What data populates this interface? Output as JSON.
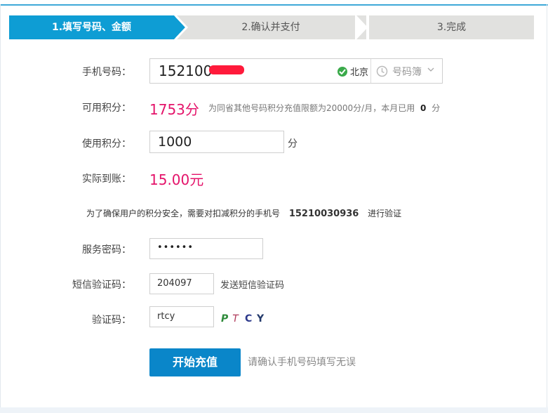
{
  "colors": {
    "accent": "#0e9dd4",
    "button": "#0a86c9",
    "highlight": "#e4136a",
    "ok": "#3aaa4a"
  },
  "steps": [
    {
      "label": "1.填写号码、金额",
      "active": true
    },
    {
      "label": "2.确认并支付",
      "active": false
    },
    {
      "label": "3.完成",
      "active": false
    }
  ],
  "form": {
    "phone_label": "手机号码：",
    "phone_value": "152100",
    "city": "北京",
    "phonebook_label": "号码簿",
    "points_label": "可用积分：",
    "points_value": "1753分",
    "points_note_prefix": "为同省其他号码积分充值限额为20000分/月，本月已用",
    "points_note_used": "0",
    "points_note_suffix": "分",
    "use_label": "使用积分：",
    "use_value": "1000",
    "use_unit": "分",
    "actual_label": "实际到账：",
    "actual_value": "15.00元",
    "security_prefix": "为了确保用户的积分安全，需要对扣减积分的手机号",
    "security_number": "15210030936",
    "security_suffix": "进行验证",
    "password_label": "服务密码：",
    "password_value": "••••••",
    "sms_label": "短信验证码：",
    "sms_value": "204097",
    "sms_link": "发送短信验证码",
    "captcha_label": "验证码：",
    "captcha_value": "rtcy",
    "captcha_chars": [
      "P",
      "T",
      "C",
      "Y"
    ]
  },
  "actions": {
    "submit_label": "开始充值",
    "hint": "请确认手机号码填写无误"
  }
}
